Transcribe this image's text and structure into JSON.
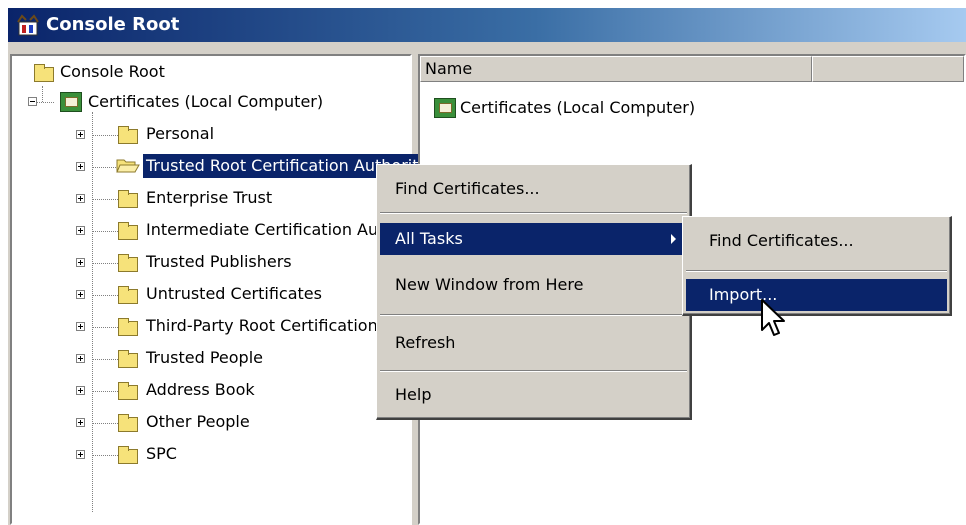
{
  "window": {
    "title": "Console Root"
  },
  "tree": {
    "root_label": "Console Root",
    "cert_node_label": "Certificates (Local Computer)",
    "items": [
      {
        "label": "Personal"
      },
      {
        "label": "Trusted Root Certification Authorities"
      },
      {
        "label": "Enterprise Trust"
      },
      {
        "label": "Intermediate Certification Authorities"
      },
      {
        "label": "Trusted Publishers"
      },
      {
        "label": "Untrusted Certificates"
      },
      {
        "label": "Third-Party Root Certification Authorities"
      },
      {
        "label": "Trusted People"
      },
      {
        "label": "Address Book"
      },
      {
        "label": "Other People"
      },
      {
        "label": "SPC"
      }
    ],
    "selected_item": "Trusted Root Certification Authorities"
  },
  "list": {
    "columns": [
      "Name",
      ""
    ],
    "rows": [
      {
        "name": "Certificates (Local Computer)"
      }
    ]
  },
  "context_menu": {
    "items": [
      {
        "label": "Find Certificates..."
      },
      {
        "label": "All Tasks",
        "has_submenu": true,
        "highlighted": true
      },
      {
        "label": "New Window from Here"
      },
      {
        "label": "Refresh"
      },
      {
        "label": "Help"
      }
    ]
  },
  "submenu": {
    "items": [
      {
        "label": "Find Certificates..."
      },
      {
        "label": "Import...",
        "highlighted": true
      }
    ]
  },
  "colors": {
    "selection": "#0a246a",
    "titlebar_start": "#0a246a",
    "titlebar_end": "#a6caf0",
    "chrome": "#d4d0c8"
  },
  "icons": [
    "console-icon",
    "folder-icon",
    "open-folder-icon",
    "certificate-store-icon",
    "submenu-arrow-icon",
    "mouse-cursor-icon"
  ]
}
